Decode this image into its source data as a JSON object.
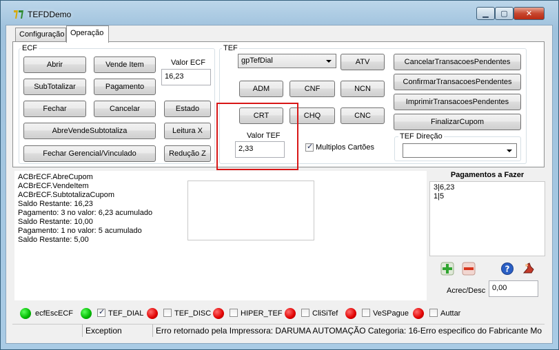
{
  "window": {
    "title": "TEFDDemo",
    "min_glyph": "▁",
    "max_glyph": "▢",
    "close_glyph": "✕"
  },
  "tabs": [
    {
      "label": "Configuração"
    },
    {
      "label": "Operação"
    }
  ],
  "ecf": {
    "group_label": "ECF",
    "buttons": {
      "abrir": "Abrir",
      "vende_item": "Vende Item",
      "subtotalizar": "SubTotalizar",
      "pagamento": "Pagamento",
      "fechar": "Fechar",
      "cancelar": "Cancelar",
      "estado": "Estado",
      "abre_vende_subtotaliza": "AbreVendeSubtotaliza",
      "leitura_x": "Leitura X",
      "fechar_gerencial": "Fechar Gerencial/Vinculado",
      "reducao_z": "Redução Z"
    },
    "valor_label": "Valor ECF",
    "valor_value": "16,23"
  },
  "tef": {
    "group_label": "TEF",
    "gp_selected": "gpTefDial",
    "buttons": {
      "atv": "ATV",
      "adm": "ADM",
      "cnf": "CNF",
      "ncn": "NCN",
      "crt": "CRT",
      "chq": "CHQ",
      "cnc": "CNC",
      "cancelar_pendentes": "CancelarTransacoesPendentes",
      "confirmar_pendentes": "ConfirmarTransacoesPendentes",
      "imprimir_pendentes": "ImprimirTransacoesPendentes",
      "finalizar_cupom": "FinalizarCupom"
    },
    "valor_label": "Valor TEF",
    "valor_value": "2,33",
    "multiplos_label": "Multiplos Cartões",
    "multiplos_checked": true,
    "direcao_label": "TEF Direção",
    "direcao_value": ""
  },
  "log": [
    "ACBrECF.AbreCupom",
    "ACBrECF.VendeItem",
    "ACBrECF.SubtotalizaCupom",
    "Saldo Restante: 16,23",
    "Pagamento: 3 no valor: 6,23 acumulado",
    "Saldo Restante: 10,00",
    "Pagamento: 1 no valor: 5 acumulado",
    "Saldo Restante: 5,00"
  ],
  "pagamentos": {
    "header": "Pagamentos a Fazer",
    "items": [
      "3|6,23",
      "1|5"
    ],
    "acrec_label": "Acrec/Desc",
    "acrec_value": "0,00"
  },
  "status_indicators": [
    {
      "label": "ecfEscECF",
      "state": "green",
      "has_checkbox": false,
      "checked": false
    },
    {
      "label": "TEF_DIAL",
      "state": "green",
      "has_checkbox": true,
      "checked": true
    },
    {
      "label": "TEF_DISC",
      "state": "red",
      "has_checkbox": true,
      "checked": false
    },
    {
      "label": "HIPER_TEF",
      "state": "red",
      "has_checkbox": true,
      "checked": false
    },
    {
      "label": "CliSiTef",
      "state": "red",
      "has_checkbox": true,
      "checked": false
    },
    {
      "label": "VeSPague",
      "state": "red",
      "has_checkbox": true,
      "checked": false
    },
    {
      "label": "Auttar",
      "state": "red",
      "has_checkbox": true,
      "checked": false
    }
  ],
  "statusbar": {
    "cell1": "",
    "cell2": "Exception",
    "cell3": "Erro retornado pela Impressora: DARUMA AUTOMAÇÃO  Categoria: 16-Erro especifico do Fabricante Mo"
  },
  "colors": {
    "green": "#00b800",
    "red": "#e00000",
    "highlight": "#d81616"
  }
}
